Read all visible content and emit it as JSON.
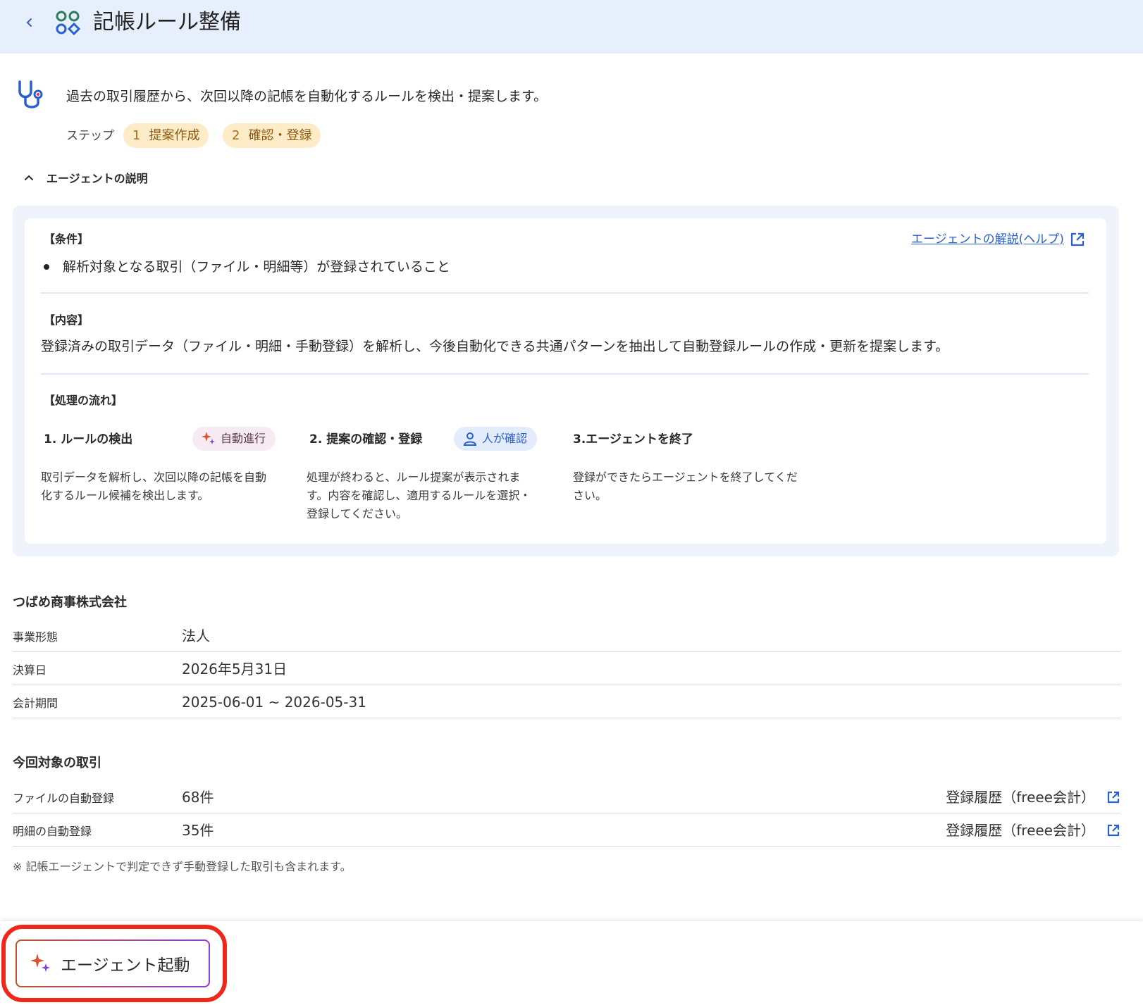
{
  "header": {
    "title": "記帳ルール整備",
    "back_icon": "chevron-left-icon",
    "app_icon": "apps-grid-icon"
  },
  "intro": {
    "icon": "stethoscope-icon",
    "text": "過去の取引履歴から、次回以降の記帳を自動化するルールを検出・提案します。",
    "steps_label": "ステップ",
    "steps": [
      {
        "num": "1",
        "label": "提案作成"
      },
      {
        "num": "2",
        "label": "確認・登録"
      }
    ]
  },
  "description_toggle": {
    "label": "エージェントの説明",
    "icon": "chevron-up-icon"
  },
  "description": {
    "help_link": "エージェントの解説(ヘルプ)",
    "conditions_heading": "【条件】",
    "conditions": [
      "解析対象となる取引（ファイル・明細等）が登録されていること"
    ],
    "content_heading": "【内容】",
    "content_text": "登録済みの取引データ（ファイル・明細・手動登録）を解析し、今後自動化できる共通パターンを抽出して自動登録ルールの作成・更新を提案します。",
    "flow_heading": "【処理の流れ】",
    "flow": [
      {
        "title": "1. ルールの検出",
        "badge": "自動進行",
        "badge_icon": "sparkle-icon",
        "desc_lines": [
          "取引データを解析し、次回以降の記帳を自動",
          "化するルール候補を検出します。"
        ]
      },
      {
        "title": "2. 提案の確認・登録",
        "badge": "人が確認",
        "badge_icon": "person-icon",
        "desc_lines": [
          "処理が終わると、ルール提案が表示されま",
          "す。内容を確認し、適用するルールを選択・",
          "登録してください。"
        ]
      },
      {
        "title": "3.エージェントを終了",
        "desc_lines": [
          "登録ができたらエージェントを終了してくだ",
          "さい。"
        ]
      }
    ]
  },
  "company": {
    "name": "つばめ商事株式会社",
    "rows": [
      {
        "key": "事業形態",
        "value": "法人"
      },
      {
        "key": "決算日",
        "value": "2026年5月31日"
      },
      {
        "key": "会計期間",
        "value": "2025-06-01 ~ 2026-05-31"
      }
    ]
  },
  "targets": {
    "title": "今回対象の取引",
    "rows": [
      {
        "key": "ファイルの自動登録",
        "value": "68件",
        "link": "登録履歴（freee会計）"
      },
      {
        "key": "明細の自動登録",
        "value": "35件",
        "link": "登録履歴（freee会計）"
      }
    ],
    "note": "※ 記帳エージェントで判定できず手動登録した取引も含まれます。"
  },
  "footer": {
    "launch_button": "エージェント起動"
  },
  "colors": {
    "header_bg": "#e8effc",
    "link": "#2a5fcf",
    "step_pill_bg": "#fdecc7",
    "highlight": "#f0271b"
  }
}
